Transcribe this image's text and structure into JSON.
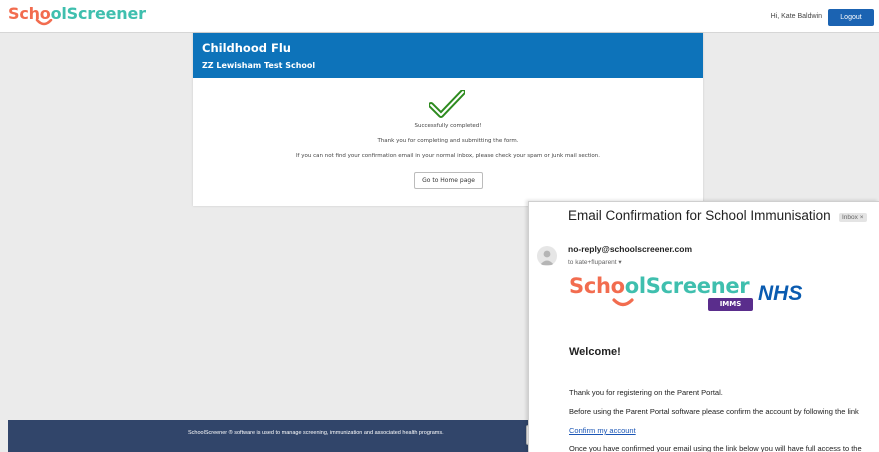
{
  "header": {
    "logo_part1": "Scho",
    "logo_part2": "ol",
    "logo_part3": "Screener",
    "greeting": "Hi, Kate Baldwin",
    "logout_label": "Logout"
  },
  "card": {
    "title": "Childhood Flu",
    "school": "ZZ Lewisham Test School",
    "success_text": "Successfully completed!",
    "thanks_text": "Thank you for completing and submitting the form.",
    "spam_text": "If you can not find your confirmation email in your normal inbox, please check your spam or junk mail section.",
    "home_button": "Go to Home page"
  },
  "footer": {
    "text": "SchoolScreener ® software is used to manage screening, immunization and associated health programs."
  },
  "email": {
    "subject": "Email Confirmation for School Immunisation",
    "label": "Inbox ×",
    "sender": "no-reply@schoolscreener.com",
    "recipient": "to kate+fluparent ▾",
    "brand_part1": "Scho",
    "brand_part2": "ol",
    "brand_part3": "Screener",
    "brand_badge": "IMMS",
    "brand_nhs": "NHS",
    "welcome": "Welcome!",
    "line1": "Thank you for registering on the Parent Portal.",
    "line2": "Before using the Parent Portal software please confirm the account by following the link",
    "link": "Confirm my account",
    "line3": "Once you have confirmed your email using the link below you will have full access to the"
  },
  "colors": {
    "brand_orange": "#f26c4f",
    "brand_teal": "#3fbfae",
    "header_blue": "#0d73ba",
    "logout_blue": "#1b63b2",
    "footer_navy": "#31456a",
    "check_green": "#2e8b1f",
    "imms_purple": "#5a2d8c",
    "nhs_blue": "#0a5bb0"
  },
  "icons": {
    "check": "check-icon",
    "avatar": "person-icon",
    "smile": "smile-icon"
  }
}
